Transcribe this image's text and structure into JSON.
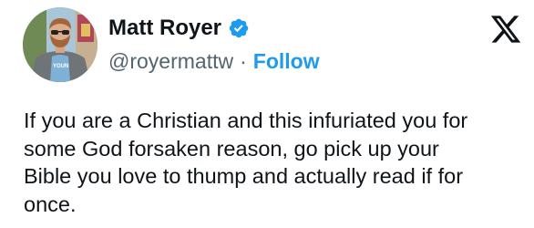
{
  "author": {
    "display_name": "Matt Royer",
    "handle": "@royermattw",
    "separator": "·",
    "follow_label": "Follow",
    "verified": true,
    "verified_icon": "verified-badge-icon",
    "avatar_shirt_text": "YOUN"
  },
  "brand": {
    "logo_icon": "x-logo-icon"
  },
  "tweet": {
    "text": "If you are a Christian and this infuriated you for\nsome God forsaken reason, go pick up your\nBible you love to thump and actually read if for\nonce."
  },
  "colors": {
    "link": "#1d9bf0",
    "text": "#0f1419",
    "secondary": "#536471",
    "verified": "#1d9bf0"
  }
}
